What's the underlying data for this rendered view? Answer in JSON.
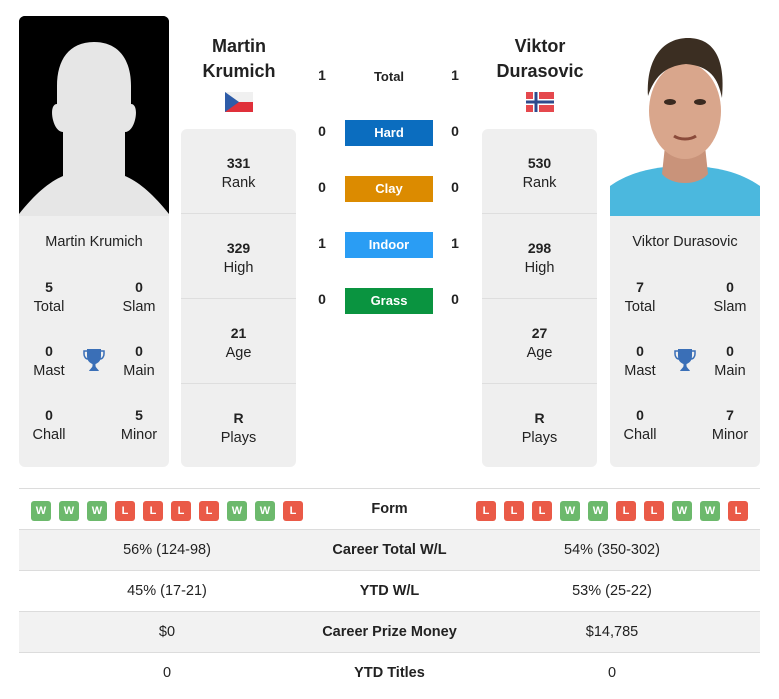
{
  "colors": {
    "hard": "#0b6dbf",
    "clay": "#dc8b00",
    "indoor": "#2a9df4",
    "grass": "#0a9440",
    "win": "#6cb96c",
    "loss": "#ea5a47",
    "trophy": "#3a6fb7"
  },
  "player1": {
    "name_line1": "Martin",
    "name_line2": "Krumich",
    "full_name": "Martin Krumich",
    "flag": "czech-republic",
    "rank": "331",
    "rank_label": "Rank",
    "high": "329",
    "high_label": "High",
    "age": "21",
    "age_label": "Age",
    "plays": "R",
    "plays_label": "Plays",
    "titles": {
      "total": "5",
      "total_label": "Total",
      "slam": "0",
      "slam_label": "Slam",
      "mast": "0",
      "mast_label": "Mast",
      "main": "0",
      "main_label": "Main",
      "chall": "0",
      "chall_label": "Chall",
      "minor": "5",
      "minor_label": "Minor"
    },
    "form": [
      "W",
      "W",
      "W",
      "L",
      "L",
      "L",
      "L",
      "W",
      "W",
      "L"
    ],
    "career_wl": "56% (124-98)",
    "ytd_wl": "45% (17-21)",
    "prize_money": "$0",
    "ytd_titles": "0"
  },
  "player2": {
    "name_line1": "Viktor",
    "name_line2": "Durasovic",
    "full_name": "Viktor Durasovic",
    "flag": "norway",
    "rank": "530",
    "rank_label": "Rank",
    "high": "298",
    "high_label": "High",
    "age": "27",
    "age_label": "Age",
    "plays": "R",
    "plays_label": "Plays",
    "titles": {
      "total": "7",
      "total_label": "Total",
      "slam": "0",
      "slam_label": "Slam",
      "mast": "0",
      "mast_label": "Mast",
      "main": "0",
      "main_label": "Main",
      "chall": "0",
      "chall_label": "Chall",
      "minor": "7",
      "minor_label": "Minor"
    },
    "form": [
      "L",
      "L",
      "L",
      "W",
      "W",
      "L",
      "L",
      "W",
      "W",
      "L"
    ],
    "career_wl": "54% (350-302)",
    "ytd_wl": "53% (25-22)",
    "prize_money": "$14,785",
    "ytd_titles": "0"
  },
  "h2h": {
    "total": {
      "label": "Total",
      "p1": "1",
      "p2": "1"
    },
    "hard": {
      "label": "Hard",
      "p1": "0",
      "p2": "0"
    },
    "clay": {
      "label": "Clay",
      "p1": "0",
      "p2": "0"
    },
    "indoor": {
      "label": "Indoor",
      "p1": "1",
      "p2": "1"
    },
    "grass": {
      "label": "Grass",
      "p1": "0",
      "p2": "0"
    }
  },
  "table_labels": {
    "form": "Form",
    "career_wl": "Career Total W/L",
    "ytd_wl": "YTD W/L",
    "prize_money": "Career Prize Money",
    "ytd_titles": "YTD Titles"
  }
}
